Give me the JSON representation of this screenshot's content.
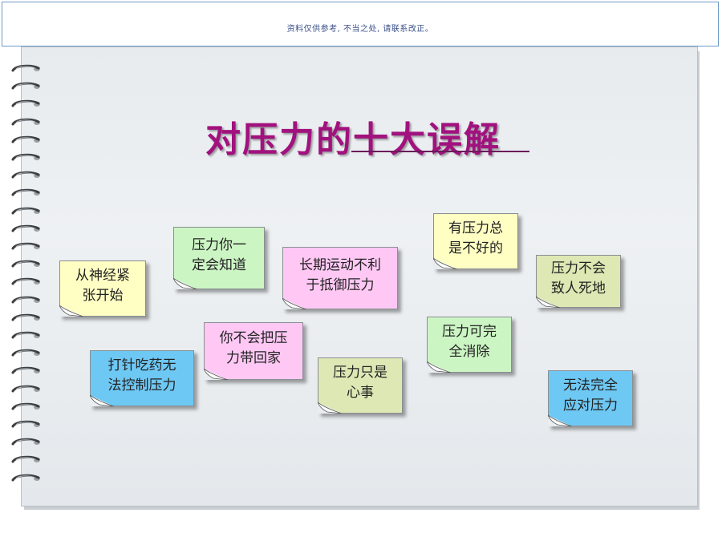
{
  "banner": {
    "text": "资料仅供参考, 不当之处, 请联系改正。"
  },
  "slide": {
    "title": "对压力的十大误解",
    "title_color": "#a1127e"
  },
  "notes": [
    {
      "text": "从神经紧\n张开始",
      "color": "#ffffc4"
    },
    {
      "text": "压力你一\n定会知道",
      "color": "#ccf5c4"
    },
    {
      "text": "长期运动不利\n于抵御压力",
      "color": "#ffc8f4"
    },
    {
      "text": "有压力总\n是不好的",
      "color": "#ffffc4"
    },
    {
      "text": "压力不会\n致人死地",
      "color": "#dde8b4"
    },
    {
      "text": "你不会把压\n力带回家",
      "color": "#ffc8f4"
    },
    {
      "text": "打针吃药无\n法控制压力",
      "color": "#6ec8f4"
    },
    {
      "text": "压力只是\n心事",
      "color": "#dde8b4"
    },
    {
      "text": "压力可完\n全消除",
      "color": "#ccf5c4"
    },
    {
      "text": "无法完全\n应对压力",
      "color": "#6ec8f4"
    }
  ]
}
